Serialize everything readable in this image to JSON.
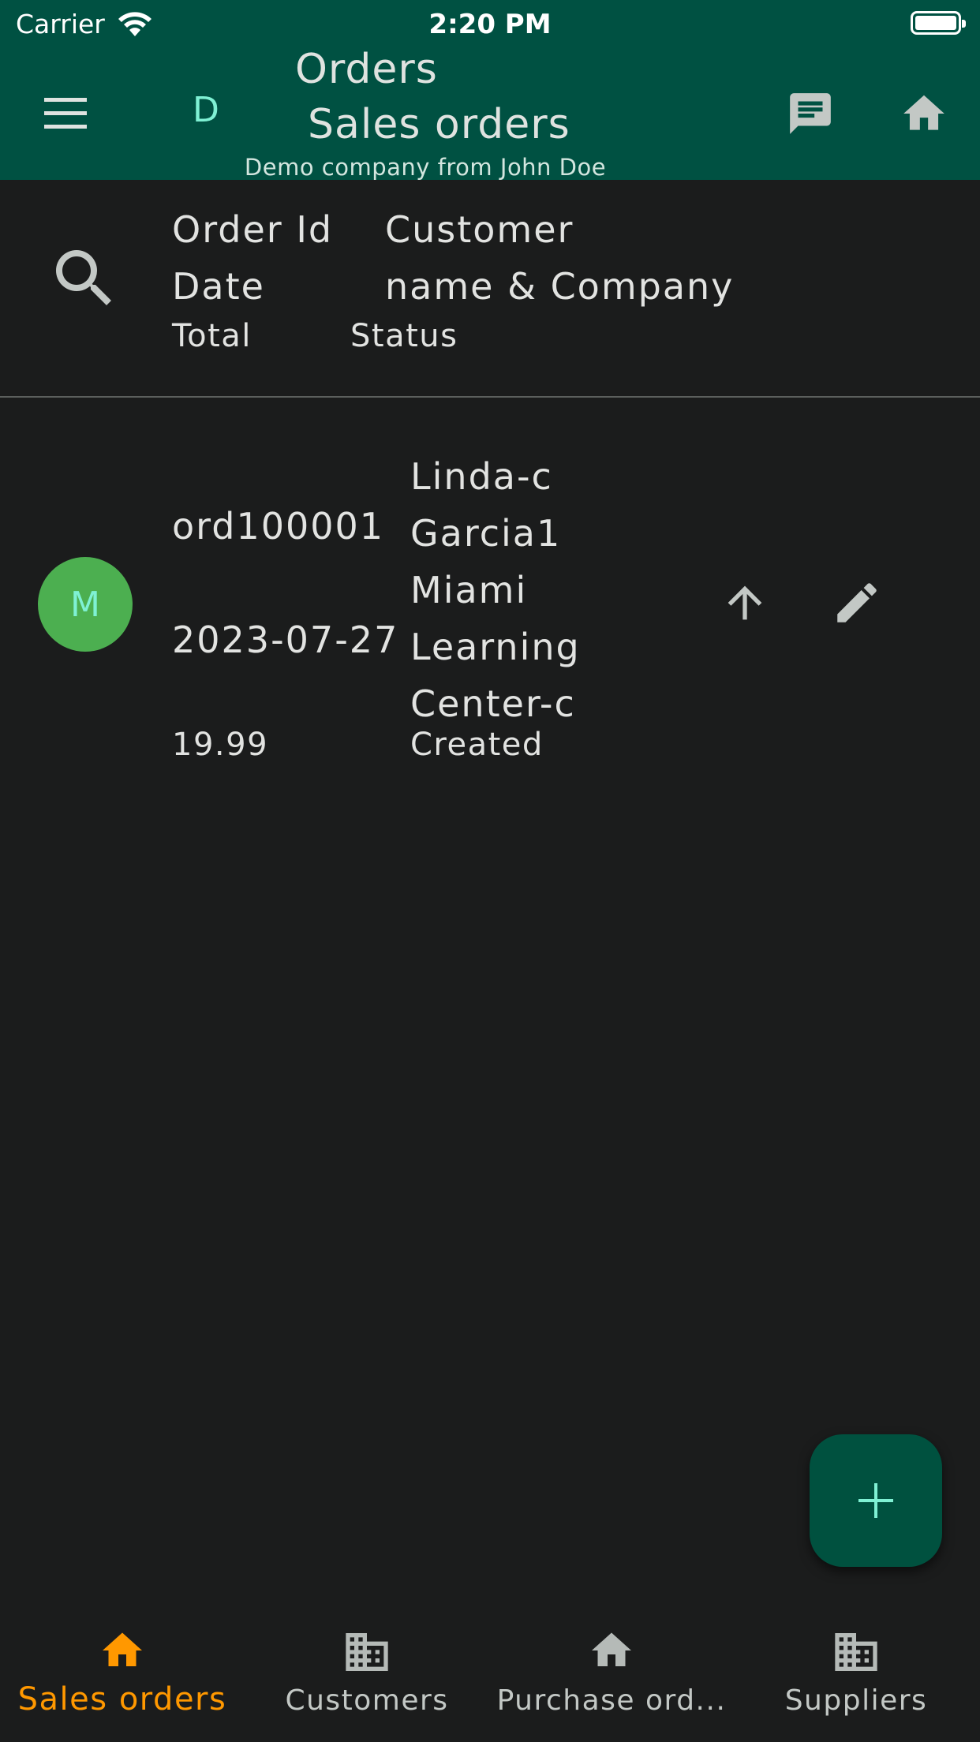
{
  "status_bar": {
    "carrier": "Carrier",
    "time": "2:20 PM"
  },
  "app_bar": {
    "company_initial": "D",
    "title": "Orders",
    "subtitle": "Sales orders",
    "company_line": "Demo company from John Doe",
    "icons": {
      "menu": "menu-icon",
      "chat": "chat-icon",
      "home": "home-icon"
    },
    "background_color": "#005142"
  },
  "columns": {
    "order_id": "Order Id",
    "date": "Date",
    "total": "Total",
    "customer_line1": "Customer",
    "customer_line2": "name & Company",
    "status": "Status"
  },
  "orders": [
    {
      "avatar_initial": "M",
      "avatar_color": "#4caf50",
      "order_id": "ord100001",
      "date": "2023-07-27",
      "total": "19.99",
      "customer_lines": [
        "Linda-c",
        "Garcia1",
        "Miami",
        "Learning",
        "Center-c"
      ],
      "status": "Created"
    }
  ],
  "fab": {
    "icon": "plus-icon"
  },
  "bottom_nav": {
    "active_color": "#ff9800",
    "items": [
      {
        "label": "Sales orders",
        "icon": "home-icon",
        "active": true
      },
      {
        "label": "Customers",
        "icon": "building-icon",
        "active": false
      },
      {
        "label": "Purchase ord...",
        "icon": "home-icon",
        "active": false
      },
      {
        "label": "Suppliers",
        "icon": "building-icon",
        "active": false
      }
    ]
  }
}
